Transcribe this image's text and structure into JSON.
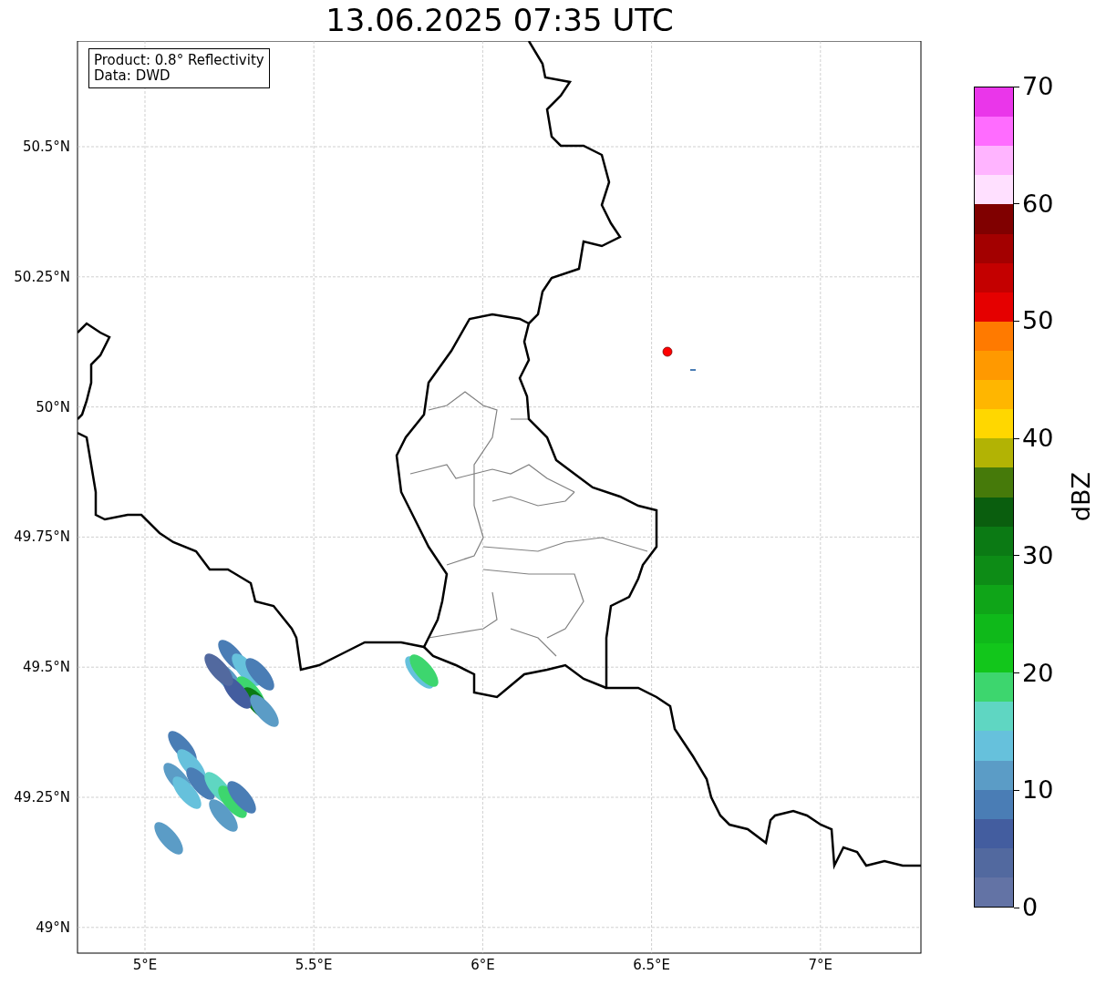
{
  "title": "13.06.2025 07:35 UTC",
  "legend": {
    "lines": [
      "Product: 0.8° Reflectivity",
      "Data: DWD"
    ]
  },
  "map": {
    "x_ticks": [
      "5°E",
      "5.5°E",
      "6°E",
      "6.5°E",
      "7°E"
    ],
    "y_ticks": [
      "50.5°N",
      "50.25°N",
      "50°N",
      "49.75°N",
      "49.5°N",
      "49.25°N",
      "49°N"
    ]
  },
  "colorbar": {
    "label": "dBZ",
    "ticks": [
      "70",
      "60",
      "50",
      "40",
      "30",
      "20",
      "10",
      "0"
    ],
    "bins": [
      {
        "color": "#ea36ea"
      },
      {
        "color": "#ff6cff"
      },
      {
        "color": "#ffb4ff"
      },
      {
        "color": "#ffe0ff"
      },
      {
        "color": "#800000"
      },
      {
        "color": "#a30000"
      },
      {
        "color": "#c40000"
      },
      {
        "color": "#e50000"
      },
      {
        "color": "#ff7a00"
      },
      {
        "color": "#ff9900"
      },
      {
        "color": "#ffb600"
      },
      {
        "color": "#ffd700"
      },
      {
        "color": "#b2b304"
      },
      {
        "color": "#467a0a"
      },
      {
        "color": "#0a5e0e"
      },
      {
        "color": "#0b7a14"
      },
      {
        "color": "#0d8c16"
      },
      {
        "color": "#0fa518"
      },
      {
        "color": "#0fb91a"
      },
      {
        "color": "#12c61b"
      },
      {
        "color": "#3dd66e"
      },
      {
        "color": "#5fd6c2"
      },
      {
        "color": "#66c1dc"
      },
      {
        "color": "#5b9cc6"
      },
      {
        "color": "#4a7db5"
      },
      {
        "color": "#435d9f"
      },
      {
        "color": "#52699f"
      },
      {
        "color": "#6373a5"
      }
    ]
  }
}
